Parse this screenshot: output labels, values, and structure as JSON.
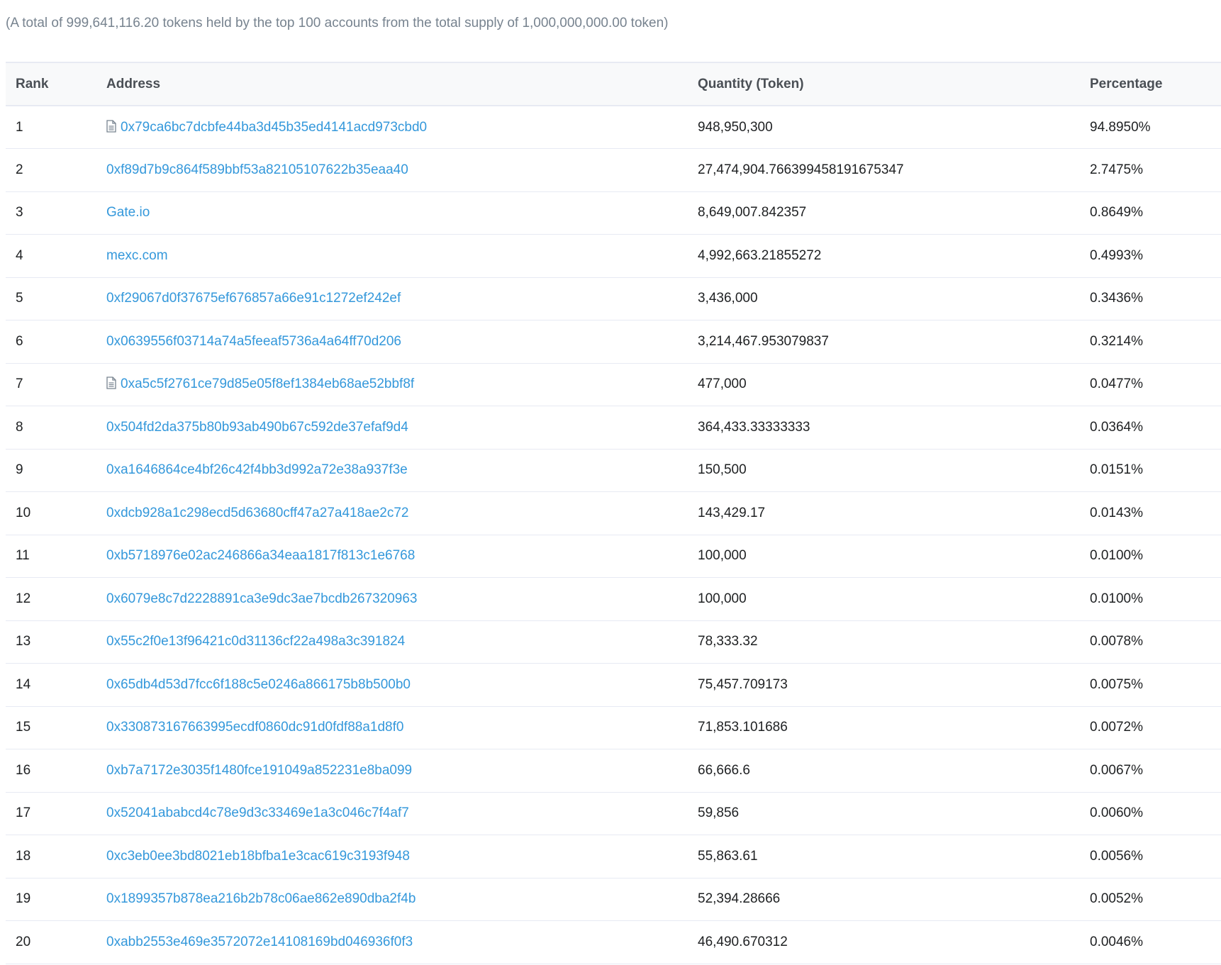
{
  "summary": "(A total of 999,641,116.20 tokens held by the top 100 accounts from the total supply of 1,000,000,000.00 token)",
  "table": {
    "headers": {
      "rank": "Rank",
      "address": "Address",
      "quantity": "Quantity (Token)",
      "percentage": "Percentage"
    },
    "rows": [
      {
        "rank": "1",
        "address": "0x79ca6bc7dcbfe44ba3d45b35ed4141acd973cbd0",
        "icon": "contract-document-icon",
        "quantity": "948,950,300",
        "percentage": "94.8950%"
      },
      {
        "rank": "2",
        "address": "0xf89d7b9c864f589bbf53a82105107622b35eaa40",
        "icon": "",
        "quantity": "27,474,904.766399458191675347",
        "percentage": "2.7475%"
      },
      {
        "rank": "3",
        "address": "Gate.io",
        "icon": "",
        "quantity": "8,649,007.842357",
        "percentage": "0.8649%"
      },
      {
        "rank": "4",
        "address": "mexc.com",
        "icon": "",
        "quantity": "4,992,663.21855272",
        "percentage": "0.4993%"
      },
      {
        "rank": "5",
        "address": "0xf29067d0f37675ef676857a66e91c1272ef242ef",
        "icon": "",
        "quantity": "3,436,000",
        "percentage": "0.3436%"
      },
      {
        "rank": "6",
        "address": "0x0639556f03714a74a5feeaf5736a4a64ff70d206",
        "icon": "",
        "quantity": "3,214,467.953079837",
        "percentage": "0.3214%"
      },
      {
        "rank": "7",
        "address": "0xa5c5f2761ce79d85e05f8ef1384eb68ae52bbf8f",
        "icon": "contract-document-icon",
        "quantity": "477,000",
        "percentage": "0.0477%"
      },
      {
        "rank": "8",
        "address": "0x504fd2da375b80b93ab490b67c592de37efaf9d4",
        "icon": "",
        "quantity": "364,433.33333333",
        "percentage": "0.0364%"
      },
      {
        "rank": "9",
        "address": "0xa1646864ce4bf26c42f4bb3d992a72e38a937f3e",
        "icon": "",
        "quantity": "150,500",
        "percentage": "0.0151%"
      },
      {
        "rank": "10",
        "address": "0xdcb928a1c298ecd5d63680cff47a27a418ae2c72",
        "icon": "",
        "quantity": "143,429.17",
        "percentage": "0.0143%"
      },
      {
        "rank": "11",
        "address": "0xb5718976e02ac246866a34eaa1817f813c1e6768",
        "icon": "",
        "quantity": "100,000",
        "percentage": "0.0100%"
      },
      {
        "rank": "12",
        "address": "0x6079e8c7d2228891ca3e9dc3ae7bcdb267320963",
        "icon": "",
        "quantity": "100,000",
        "percentage": "0.0100%"
      },
      {
        "rank": "13",
        "address": "0x55c2f0e13f96421c0d31136cf22a498a3c391824",
        "icon": "",
        "quantity": "78,333.32",
        "percentage": "0.0078%"
      },
      {
        "rank": "14",
        "address": "0x65db4d53d7fcc6f188c5e0246a866175b8b500b0",
        "icon": "",
        "quantity": "75,457.709173",
        "percentage": "0.0075%"
      },
      {
        "rank": "15",
        "address": "0x330873167663995ecdf0860dc91d0fdf88a1d8f0",
        "icon": "",
        "quantity": "71,853.101686",
        "percentage": "0.0072%"
      },
      {
        "rank": "16",
        "address": "0xb7a7172e3035f1480fce191049a852231e8ba099",
        "icon": "",
        "quantity": "66,666.6",
        "percentage": "0.0067%"
      },
      {
        "rank": "17",
        "address": "0x52041ababcd4c78e9d3c33469e1a3c046c7f4af7",
        "icon": "",
        "quantity": "59,856",
        "percentage": "0.0060%"
      },
      {
        "rank": "18",
        "address": "0xc3eb0ee3bd8021eb18bfba1e3cac619c3193f948",
        "icon": "",
        "quantity": "55,863.61",
        "percentage": "0.0056%"
      },
      {
        "rank": "19",
        "address": "0x1899357b878ea216b2b78c06ae862e890dba2f4b",
        "icon": "",
        "quantity": "52,394.28666",
        "percentage": "0.0052%"
      },
      {
        "rank": "20",
        "address": "0xabb2553e469e3572072e14108169bd046936f0f3",
        "icon": "",
        "quantity": "46,490.670312",
        "percentage": "0.0046%"
      }
    ]
  },
  "colors": {
    "link": "#3498db",
    "text": "#1e2022",
    "muted": "#77838f",
    "header_bg": "#f8f9fa",
    "border": "#e7eaf3"
  }
}
